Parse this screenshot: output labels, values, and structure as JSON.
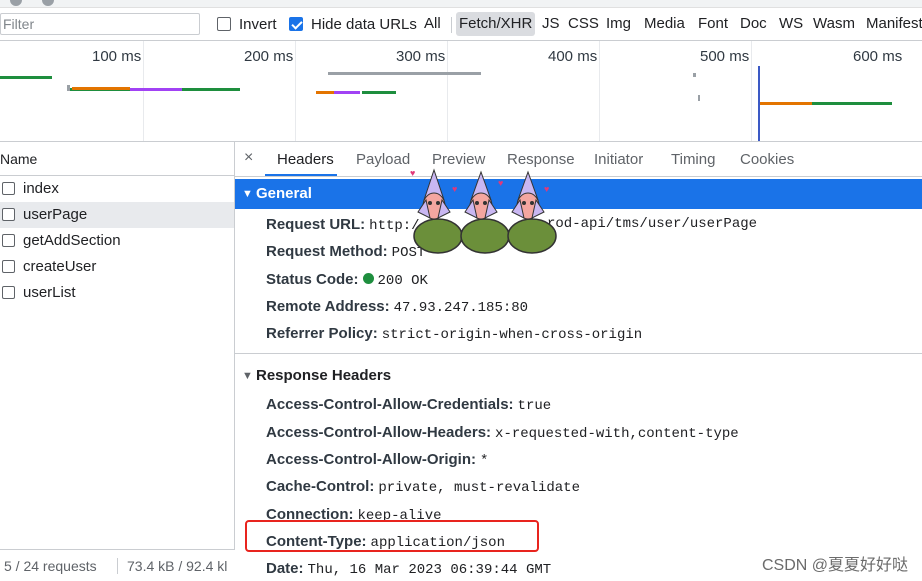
{
  "filter": {
    "placeholder": "Filter",
    "invert_label": "Invert",
    "hide_data_urls_label": "Hide data URLs",
    "types": [
      "All",
      "Fetch/XHR",
      "JS",
      "CSS",
      "Img",
      "Media",
      "Font",
      "Doc",
      "WS",
      "Wasm",
      "Manifest"
    ]
  },
  "overview": {
    "ticks": [
      "100 ms",
      "200 ms",
      "300 ms",
      "400 ms",
      "500 ms",
      "600 ms"
    ]
  },
  "request_list": {
    "column_header": "Name",
    "items": [
      {
        "name": "index",
        "selected": false
      },
      {
        "name": "userPage",
        "selected": true
      },
      {
        "name": "getAddSection",
        "selected": false
      },
      {
        "name": "createUser",
        "selected": false
      },
      {
        "name": "userList",
        "selected": false
      }
    ],
    "footer": {
      "requests": "5 / 24 requests",
      "size": "73.4 kB / 92.4 kl"
    }
  },
  "detail": {
    "close_label": "×",
    "tabs": [
      "Headers",
      "Payload",
      "Preview",
      "Response",
      "Initiator",
      "Timing",
      "Cookies"
    ],
    "active_tab": "Headers",
    "general": {
      "title": "General",
      "rows": [
        {
          "key": "Request URL:",
          "value": "http:/",
          "tail": "rod-api/tms/user/userPage"
        },
        {
          "key": "Request Method:",
          "value": "POST"
        },
        {
          "key": "Status Code:",
          "value": "200 OK",
          "status_color": "#1e8e3e"
        },
        {
          "key": "Remote Address:",
          "value": "47.93.247.185:80"
        },
        {
          "key": "Referrer Policy:",
          "value": "strict-origin-when-cross-origin"
        }
      ]
    },
    "response_headers": {
      "title": "Response Headers",
      "rows": [
        {
          "key": "Access-Control-Allow-Credentials:",
          "value": "true"
        },
        {
          "key": "Access-Control-Allow-Headers:",
          "value": "x-requested-with,content-type"
        },
        {
          "key": "Access-Control-Allow-Origin:",
          "value": "*"
        },
        {
          "key": "Cache-Control:",
          "value": "private, must-revalidate"
        },
        {
          "key": "Connection:",
          "value": "keep-alive"
        },
        {
          "key": "Content-Type:",
          "value": "application/json"
        },
        {
          "key": "Date:",
          "value": "Thu, 16 Mar 2023 06:39:44 GMT"
        }
      ]
    }
  },
  "watermark": "CSDN @夏夏好好哒",
  "colors": {
    "accent": "#1a73e8",
    "highlight": "#e8241e",
    "status_ok": "#1e8e3e"
  }
}
